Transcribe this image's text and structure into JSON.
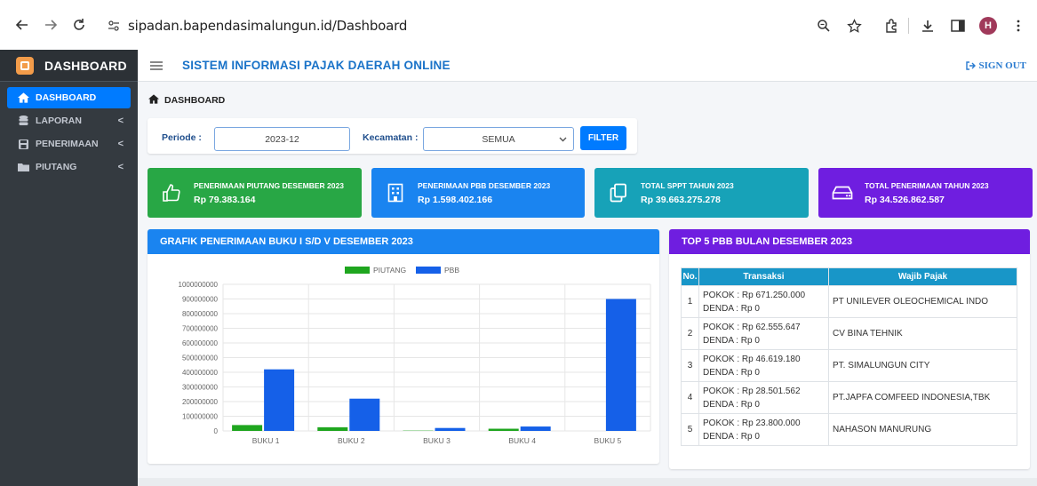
{
  "browser": {
    "url": "sipadan.bapendasimalungun.id/Dashboard",
    "avatar_letter": "H"
  },
  "sidebar": {
    "brand": "DASHBOARD",
    "items": [
      {
        "label": "DASHBOARD",
        "icon": "home-icon",
        "active": true
      },
      {
        "label": "LAPORAN",
        "icon": "database-icon",
        "chevron": "<"
      },
      {
        "label": "PENERIMAAN",
        "icon": "save-icon",
        "chevron": "<"
      },
      {
        "label": "PIUTANG",
        "icon": "folder-icon",
        "chevron": "<"
      }
    ]
  },
  "header": {
    "title": "SISTEM INFORMASI PAJAK DAERAH ONLINE",
    "signout": "SIGN OUT"
  },
  "breadcrumb": "DASHBOARD",
  "filter": {
    "periode_label": "Periode :",
    "periode_value": "2023-12",
    "kecamatan_label": "Kecamatan :",
    "kecamatan_value": "SEMUA",
    "button": "FILTER"
  },
  "stats": [
    {
      "label": "PENERIMAAN PIUTANG DESEMBER 2023",
      "value": "Rp 79.383.164",
      "color": "#28a745",
      "icon": "thumbs-up-icon"
    },
    {
      "label": "PENERIMAAN PBB DESEMBER 2023",
      "value": "Rp 1.598.402.166",
      "color": "#1a84f0",
      "icon": "building-icon"
    },
    {
      "label": "TOTAL SPPT TAHUN 2023",
      "value": "Rp 39.663.275.278",
      "color": "#17a2b8",
      "icon": "copy-icon"
    },
    {
      "label": "TOTAL PENERIMAAN TAHUN 2023",
      "value": "Rp 34.526.862.587",
      "color": "#6f1ee0",
      "icon": "hdd-icon"
    }
  ],
  "chart_panel": {
    "title": "GRAFIK PENERIMAAN BUKU I S/D V DESEMBER 2023"
  },
  "chart_data": {
    "type": "bar",
    "categories": [
      "BUKU 1",
      "BUKU 2",
      "BUKU 3",
      "BUKU 4",
      "BUKU 5"
    ],
    "series": [
      {
        "name": "PIUTANG",
        "color": "#1fa61f",
        "values": [
          40000000,
          25000000,
          2000000,
          15000000,
          0
        ]
      },
      {
        "name": "PBB",
        "color": "#1560e8",
        "values": [
          420000000,
          220000000,
          20000000,
          30000000,
          900000000
        ]
      }
    ],
    "ylim": [
      0,
      1000000000
    ],
    "yticks": [
      "0",
      "100000000",
      "200000000",
      "300000000",
      "400000000",
      "500000000",
      "600000000",
      "700000000",
      "800000000",
      "900000000",
      "1000000000"
    ],
    "legend": "top-center",
    "grid": true
  },
  "table_panel": {
    "title": "TOP 5 PBB BULAN DESEMBER 2023",
    "columns": [
      "No.",
      "Transaksi",
      "Wajib Pajak"
    ],
    "rows": [
      {
        "no": "1",
        "pokok": "POKOK : Rp 671.250.000",
        "denda": "DENDA : Rp 0",
        "wp": "PT UNILEVER OLEOCHEMICAL INDO"
      },
      {
        "no": "2",
        "pokok": "POKOK : Rp 62.555.647",
        "denda": "DENDA : Rp 0",
        "wp": "CV BINA TEHNIK"
      },
      {
        "no": "3",
        "pokok": "POKOK : Rp 46.619.180",
        "denda": "DENDA : Rp 0",
        "wp": "PT. SIMALUNGUN CITY"
      },
      {
        "no": "4",
        "pokok": "POKOK : Rp 28.501.562",
        "denda": "DENDA : Rp 0",
        "wp": "PT.JAPFA COMFEED INDONESIA,TBK"
      },
      {
        "no": "5",
        "pokok": "POKOK : Rp 23.800.000",
        "denda": "DENDA : Rp 0",
        "wp": "NAHASON MANURUNG"
      }
    ]
  }
}
